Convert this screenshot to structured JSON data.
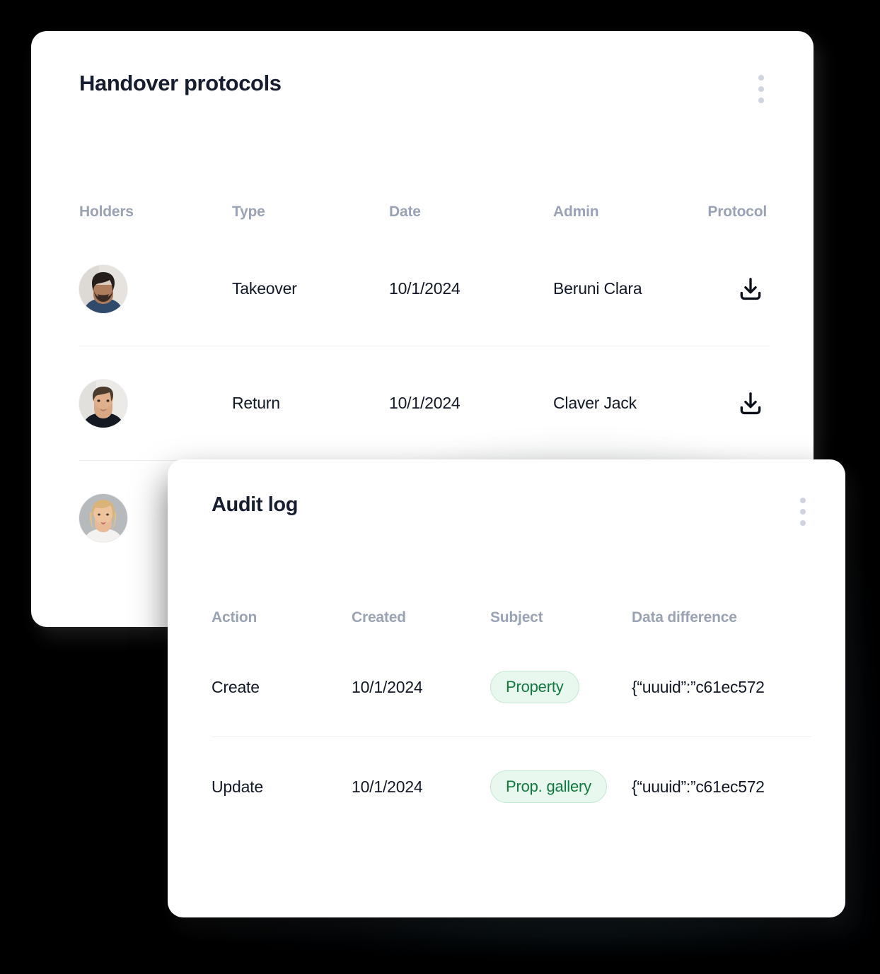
{
  "colors": {
    "page_background": "#000000",
    "card_background": "#ffffff",
    "title_text": "#161d2e",
    "header_text": "#9aa3b5",
    "body_text": "#121826",
    "divider": "#eceef2",
    "badge_background": "#e9f8ef",
    "badge_border": "#c3ead2",
    "badge_text": "#10793f",
    "kebab_dot": "#cfd4de"
  },
  "handover_card": {
    "title": "Handover protocols",
    "menu_icon": "kebab-menu-icon",
    "columns": [
      "Holders",
      "Type",
      "Date",
      "Admin",
      "Protocol"
    ],
    "rows": [
      {
        "holder_avatar": "avatar-bearded-man",
        "type": "Takeover",
        "date": "10/1/2024",
        "admin": "Beruni Clara",
        "protocol_icon": "download-icon"
      },
      {
        "holder_avatar": "avatar-short-hair-man",
        "type": "Return",
        "date": "10/1/2024",
        "admin": "Claver Jack",
        "protocol_icon": "download-icon"
      },
      {
        "holder_avatar": "avatar-blonde-woman",
        "type": "",
        "date": "",
        "admin": "",
        "protocol_icon": ""
      }
    ]
  },
  "audit_card": {
    "title": "Audit log",
    "menu_icon": "kebab-menu-icon",
    "columns": [
      "Action",
      "Created",
      "Subject",
      "Data difference"
    ],
    "rows": [
      {
        "action": "Create",
        "created": "10/1/2024",
        "subject": "Property",
        "data_difference": "{“uuuid”:”c61ec572"
      },
      {
        "action": "Update",
        "created": "10/1/2024",
        "subject": "Prop. gallery",
        "data_difference": "{“uuuid”:”c61ec572"
      }
    ]
  }
}
